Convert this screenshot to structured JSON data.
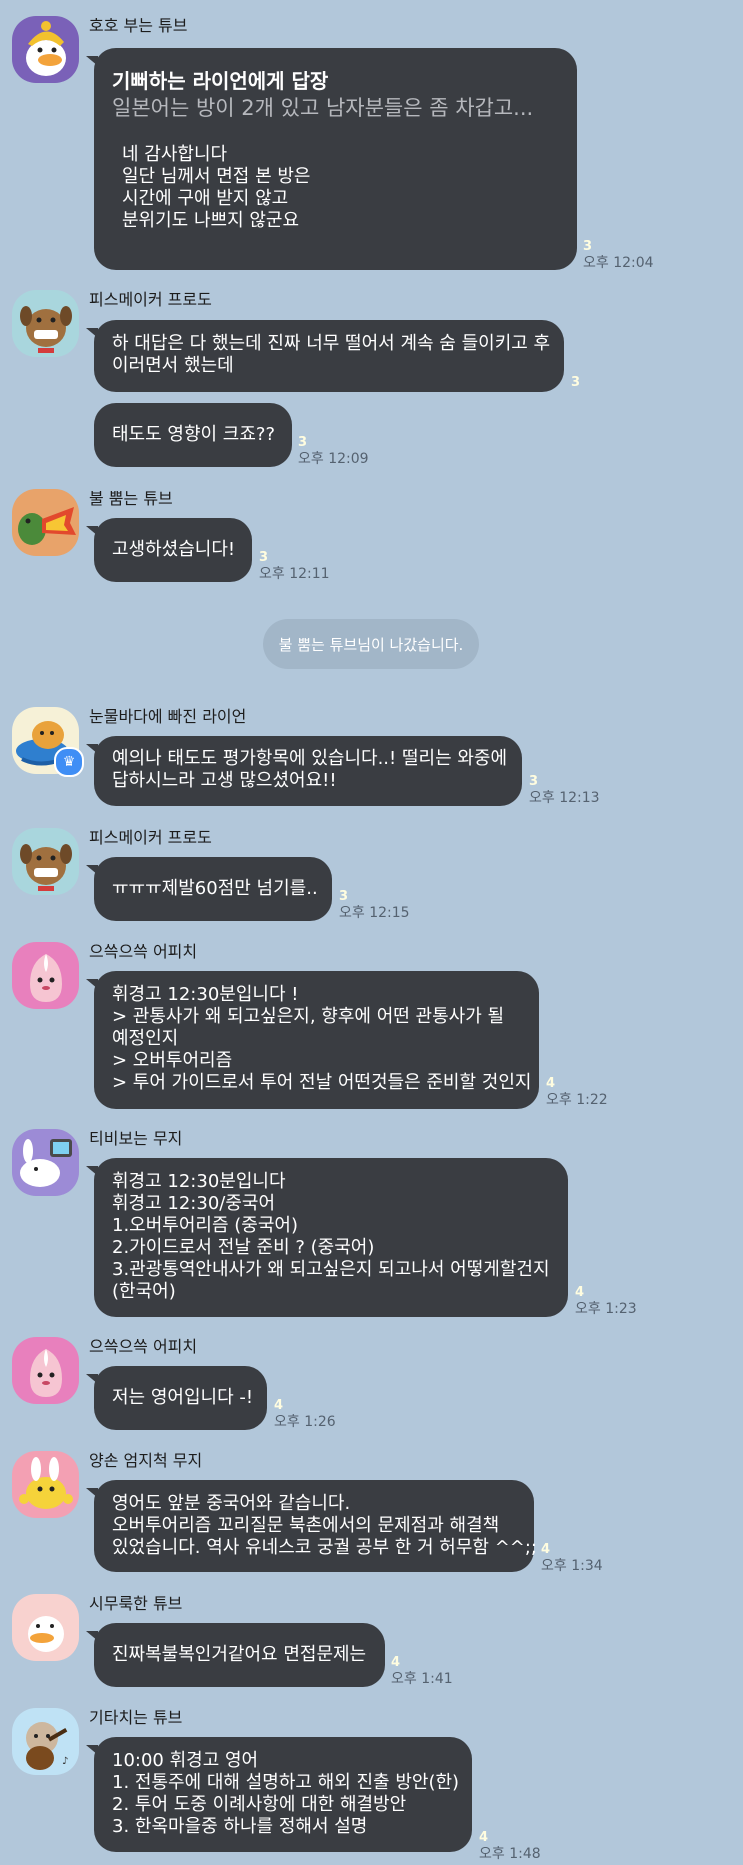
{
  "chat": {
    "messages": [
      {
        "sender": "호호 부는 튜브",
        "reply_to": "기뻐하는 라이언에게 답장",
        "reply_preview": "일본어는 방이 2개 있고 남자분들은 좀 차갑고...",
        "lines": [
          "네 감사합니다",
          "일단 님께서 면접 본 방은",
          "시간에 구애 받지 않고",
          "분위기도 나쁘지 않군요"
        ],
        "unread": "3",
        "time": "오후 12:04"
      },
      {
        "sender": "피스메이커 프로도",
        "lines": [
          "하 대답은 다 했는데 진짜 너무 떨어서 계속 숨 들이키고 후",
          "이러면서 했는데"
        ],
        "unread": "3"
      },
      {
        "lines": [
          "태도도 영향이 크죠??"
        ],
        "unread": "3",
        "time": "오후 12:09"
      },
      {
        "sender": "불 뿜는 튜브",
        "lines": [
          "고생하셨습니다!"
        ],
        "unread": "3",
        "time": "오후 12:11"
      },
      {
        "sender": "눈물바다에 빠진 라이언",
        "lines": [
          "예의나 태도도 평가항목에 있습니다..! 떨리는 와중에",
          "답하시느라 고생 많으셨어요!!"
        ],
        "unread": "3",
        "time": "오후 12:13"
      },
      {
        "sender": "피스메이커 프로도",
        "lines": [
          "ㅠㅠㅠ제발60점만 넘기를.."
        ],
        "unread": "3",
        "time": "오후 12:15"
      },
      {
        "sender": "으쓱으쓱 어피치",
        "lines": [
          "휘경고 12:30분입니다 !",
          "> 관통사가 왜 되고싶은지, 향후에 어떤 관통사가 될",
          "예정인지",
          "> 오버투어리즘",
          "> 투어 가이드로서 투어 전날 어떤것들은 준비할 것인지"
        ],
        "unread": "4",
        "time": "오후 1:22"
      },
      {
        "sender": "티비보는 무지",
        "lines": [
          "휘경고 12:30분입니다",
          "휘경고 12:30/중국어",
          "1.오버투어리즘 (중국어)",
          "2.가이드로서 전날 준비 ? (중국어)",
          "3.관광통역안내사가 왜 되고싶은지 되고나서 어떻게할건지",
          "(한국어)"
        ],
        "unread": "4",
        "time": "오후 1:23"
      },
      {
        "sender": "으쓱으쓱 어피치",
        "lines": [
          "저는 영어입니다 -!"
        ],
        "unread": "4",
        "time": "오후 1:26"
      },
      {
        "sender": "양손 엄지척 무지",
        "lines": [
          "영어도 앞분 중국어와 같습니다.",
          "오버투어리즘 꼬리질문 북촌에서의 문제점과 해결책",
          "있었습니다. 역사 유네스코  궁궐 공부 한 거 허무함 ^^;;"
        ],
        "unread": "4",
        "time": "오후 1:34"
      },
      {
        "sender": "시무룩한 튜브",
        "lines": [
          "진짜복불복인거같어요 면접문제는"
        ],
        "unread": "4",
        "time": "오후 1:41"
      },
      {
        "sender": "기타치는 튜브",
        "lines": [
          "10:00 휘경고 영어",
          "1. 전통주에 대해 설명하고 해외 진출 방안(한)",
          "2. 투어 도중 이례사항에 대한 해결방안",
          "3. 한옥마을중 하나를 정해서 설명"
        ],
        "unread": "4",
        "time": "오후 1:48"
      }
    ],
    "system_notice": "불 뿜는 튜브님이 나갔습니다."
  }
}
